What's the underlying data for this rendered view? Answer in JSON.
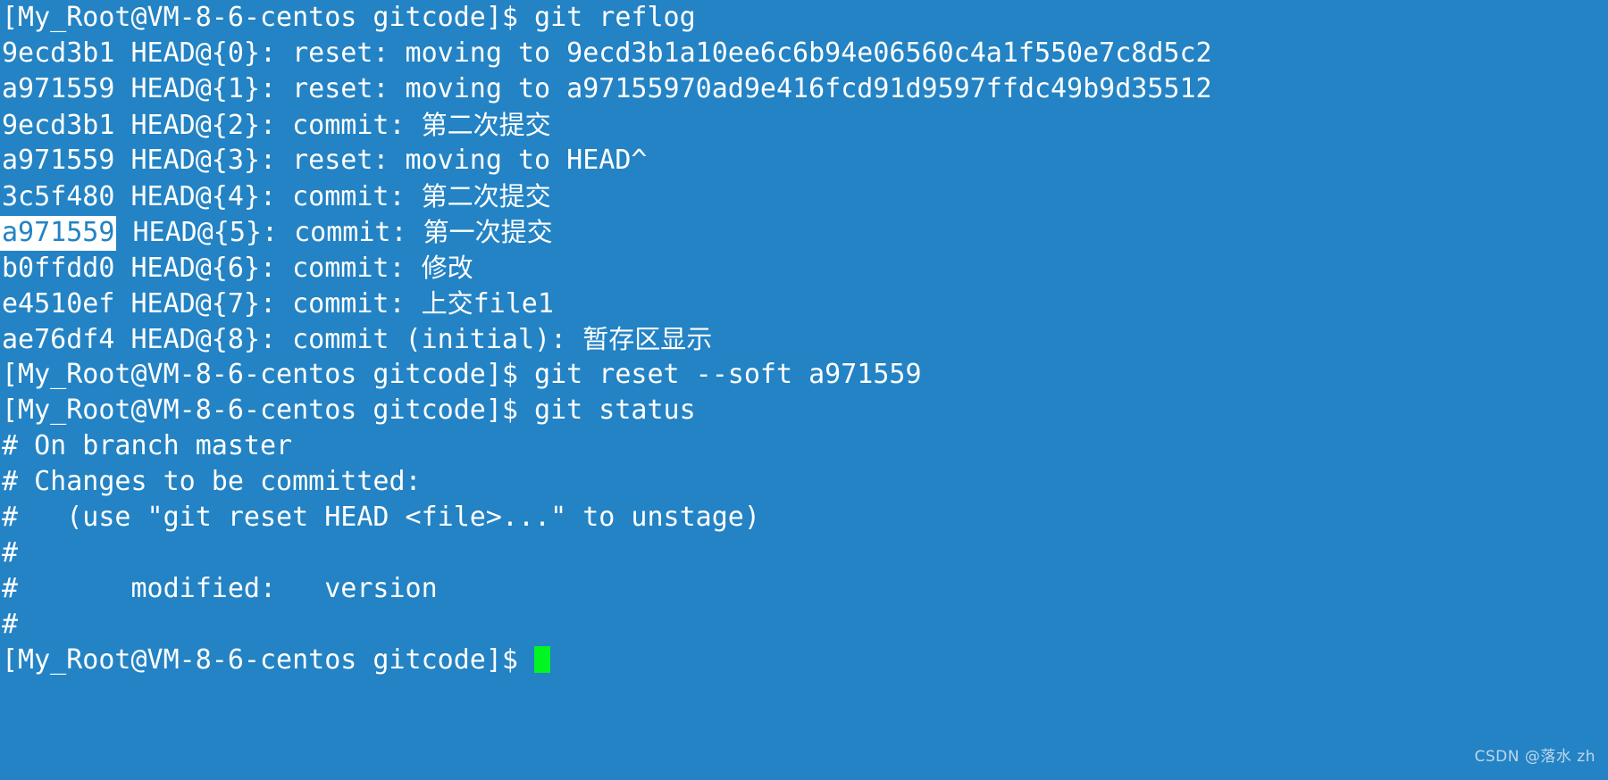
{
  "terminal": {
    "background_color": "#2383c4",
    "foreground_color": "#ffffff",
    "cursor_color": "#00f522",
    "highlight_bg_color": "#ffffff",
    "highlight_fg_color": "#2383c4",
    "font_size_px": 30,
    "line_height_px": 40,
    "columns": 92,
    "rows": 22,
    "prompt": "[My_Root@VM-8-6-centos gitcode]$ "
  },
  "lines": [
    {
      "id": "cmd-git-reflog",
      "segments": [
        {
          "text": "[My_Root@VM-8-6-centos gitcode]$ git reflog",
          "style": "plain"
        }
      ]
    },
    {
      "id": "reflog-0",
      "segments": [
        {
          "text": "9ecd3b1 HEAD@{0}: reset: moving to 9ecd3b1a10ee6c6b94e06560c4a1f550e7c8d5c2",
          "style": "plain"
        }
      ]
    },
    {
      "id": "reflog-1",
      "segments": [
        {
          "text": "a971559 HEAD@{1}: reset: moving to a97155970ad9e416fcd91d9597ffdc49b9d35512",
          "style": "plain"
        }
      ]
    },
    {
      "id": "reflog-2",
      "segments": [
        {
          "text": "9ecd3b1 HEAD@{2}: commit: ",
          "style": "plain"
        },
        {
          "text": "第二次提交",
          "style": "cn"
        }
      ]
    },
    {
      "id": "reflog-3",
      "segments": [
        {
          "text": "a971559 HEAD@{3}: reset: moving to HEAD^",
          "style": "plain"
        }
      ]
    },
    {
      "id": "reflog-4",
      "segments": [
        {
          "text": "3c5f480 HEAD@{4}: commit: ",
          "style": "plain"
        },
        {
          "text": "第二次提交",
          "style": "cn"
        }
      ]
    },
    {
      "id": "reflog-5",
      "segments": [
        {
          "text": "a971559",
          "style": "highlight"
        },
        {
          "text": " HEAD@{5}: commit: ",
          "style": "plain"
        },
        {
          "text": "第一次提交",
          "style": "cn"
        }
      ]
    },
    {
      "id": "reflog-6",
      "segments": [
        {
          "text": "b0ffdd0 HEAD@{6}: commit: ",
          "style": "plain"
        },
        {
          "text": "修改",
          "style": "cn"
        }
      ]
    },
    {
      "id": "reflog-7",
      "segments": [
        {
          "text": "e4510ef HEAD@{7}: commit: ",
          "style": "plain"
        },
        {
          "text": "上交",
          "style": "cn"
        },
        {
          "text": "file1",
          "style": "plain"
        }
      ]
    },
    {
      "id": "reflog-8",
      "segments": [
        {
          "text": "ae76df4 HEAD@{8}: commit (initial): ",
          "style": "plain"
        },
        {
          "text": "暂存区显示",
          "style": "cn"
        }
      ]
    },
    {
      "id": "cmd-git-reset-soft",
      "segments": [
        {
          "text": "[My_Root@VM-8-6-centos gitcode]$ git reset --soft a971559",
          "style": "plain"
        }
      ]
    },
    {
      "id": "cmd-git-status",
      "segments": [
        {
          "text": "[My_Root@VM-8-6-centos gitcode]$ git status",
          "style": "plain"
        }
      ]
    },
    {
      "id": "status-branch",
      "segments": [
        {
          "text": "# On branch master",
          "style": "plain"
        }
      ]
    },
    {
      "id": "status-changes-header",
      "segments": [
        {
          "text": "# Changes to be committed:",
          "style": "plain"
        }
      ]
    },
    {
      "id": "status-hint-unstage",
      "segments": [
        {
          "text": "#   (use \"git reset HEAD <file>...\" to unstage)",
          "style": "plain"
        }
      ]
    },
    {
      "id": "status-blank-1",
      "segments": [
        {
          "text": "#",
          "style": "plain"
        }
      ]
    },
    {
      "id": "status-modified-version",
      "segments": [
        {
          "text": "#       modified:   version",
          "style": "plain"
        }
      ]
    },
    {
      "id": "status-blank-2",
      "segments": [
        {
          "text": "#",
          "style": "plain"
        }
      ]
    },
    {
      "id": "prompt-active",
      "segments": [
        {
          "text": "[My_Root@VM-8-6-centos gitcode]$ ",
          "style": "plain"
        },
        {
          "text": "",
          "style": "cursor"
        }
      ]
    }
  ],
  "watermark": {
    "text": "CSDN @落水 zh"
  }
}
